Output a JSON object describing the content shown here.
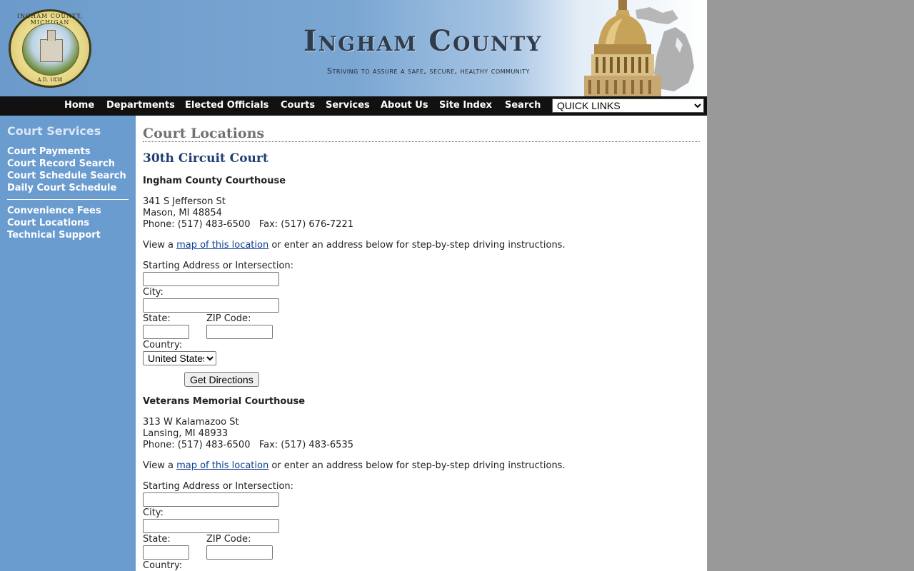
{
  "header": {
    "seal_top_text": "INGHAM COUNTY, MICHIGAN",
    "seal_bottom_text": "A.D. 1838",
    "site_title": "Ingham County",
    "tagline": "Striving to assure a safe, secure, healthy community"
  },
  "nav": {
    "items": [
      "Home",
      "Departments",
      "Elected Officials",
      "Courts",
      "Services",
      "About Us",
      "Site Index",
      "Search"
    ],
    "quick_links": "QUICK LINKS"
  },
  "sidebar": {
    "title": "Court Services",
    "group1": [
      "Court Payments",
      "Court Record Search",
      "Court Schedule Search",
      "Daily Court Schedule"
    ],
    "group2": [
      "Convenience Fees",
      "Court Locations",
      "Technical Support"
    ]
  },
  "main": {
    "page_title": "Court Locations",
    "court_heading": "30th Circuit Court",
    "locations": [
      {
        "name": "Ingham County Courthouse",
        "street": "341 S Jefferson St",
        "city_line": "Mason, MI 48854",
        "phone_line": "Phone: (517) 483-6500   Fax: (517) 676-7221",
        "view_prefix": "View a ",
        "map_link": "map of this location",
        "view_suffix": " or enter an address below for step-by-step driving instructions."
      },
      {
        "name": "Veterans Memorial Courthouse",
        "street": "313 W Kalamazoo St",
        "city_line": "Lansing, MI 48933",
        "phone_line": "Phone: (517) 483-6500   Fax: (517) 483-6535",
        "view_prefix": "View a ",
        "map_link": "map of this location",
        "view_suffix": " or enter an address below for step-by-step driving instructions."
      }
    ],
    "form": {
      "start_label": "Starting Address or Intersection:",
      "city_label": "City:",
      "state_label": "State:",
      "zip_label": "ZIP Code:",
      "country_label": "Country:",
      "country_value": "United States",
      "submit": "Get Directions"
    }
  }
}
